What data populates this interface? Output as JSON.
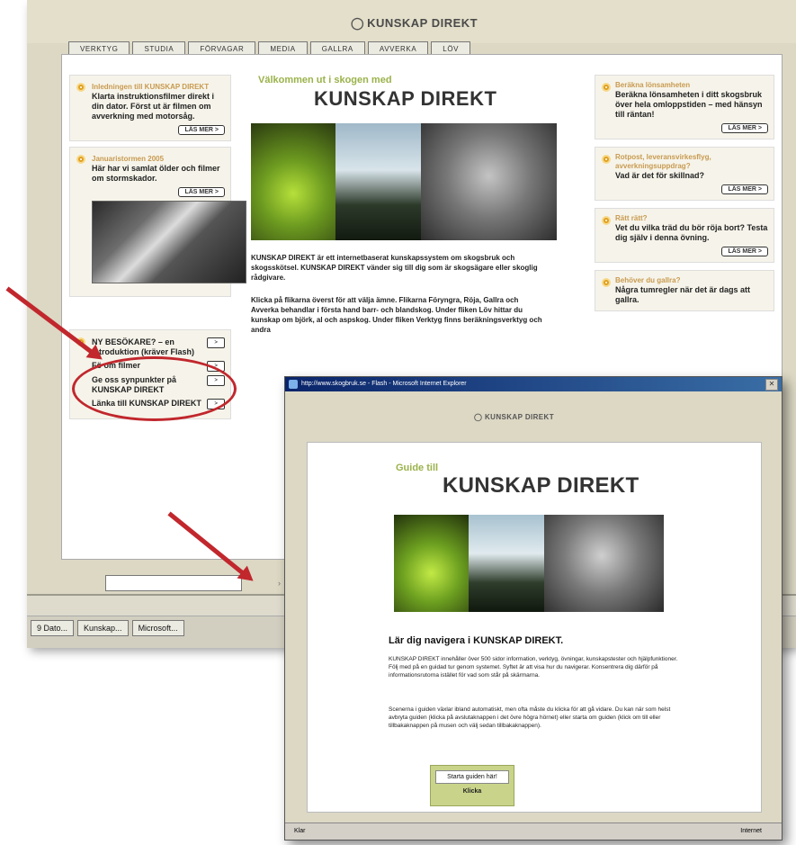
{
  "back_window": {
    "logo": "KUNSKAP DIREKT",
    "tabs": [
      "VERKTYG",
      "STUDIA",
      "FÖRVAGAR",
      "MEDIA",
      "GALLRA",
      "AVVERKA",
      "LÖV"
    ],
    "left_boxes": [
      {
        "muted": "Inledningen till KUNSKAP DIREKT",
        "strong": "Klarta instruktionsfilmer direkt i din dator. Först ut är filmen om avverkning med motorsåg.",
        "button": "LÄS MER >"
      },
      {
        "muted": "Januaristormen 2005",
        "strong": "Här har vi samlat ölder och filmer om stormskador.",
        "button": "LÄS MER >"
      }
    ],
    "left_links": [
      {
        "label": "NY BESÖKARE? – en introduktion (kräver Flash)",
        "button": ">"
      },
      {
        "label": "Fö om filmer",
        "button": ">"
      },
      {
        "label": "Ge oss synpunkter på KUNSKAP DIREKT",
        "button": ">"
      },
      {
        "label": "Länka till KUNSKAP DIREKT",
        "button": ">"
      }
    ],
    "welcome_small": "Välkommen ut i skogen med",
    "welcome_big": "KUNSKAP DIREKT",
    "mid_para1": "KUNSKAP DIREKT är ett internetbaserat kunskapssystem om skogsbruk och skogsskötsel. KUNSKAP DIREKT vänder sig till dig som är skogsägare eller skoglig rådgivare.",
    "mid_para2": "Klicka på flikarna överst för att välja ämne. Flikarna Föryngra, Röja, Gallra och Avverka behandlar i första hand barr- och blandskog. Under fliken Löv hittar du kunskap om björk, al och aspskog. Under fliken Verktyg finns beräkningsverktyg och andra",
    "right_boxes": [
      {
        "muted": "Beräkna lönsamheten",
        "strong": "Beräkna lönsamheten i ditt skogsbruk över hela omloppstiden – med hänsyn till räntan!",
        "button": "LÄS MER >"
      },
      {
        "muted": "Rotpost, leveransvirkesflyg, avverkningsuppdrag?",
        "strong": "Vad är det för skillnad?",
        "button": "LÄS MER >"
      },
      {
        "muted": "Rätt rätt?",
        "strong": "Vet du vilka träd du bör röja bort? Testa dig själv i denna övning.",
        "button": "LÄS MER >"
      },
      {
        "muted": "Behöver du gallra?",
        "strong": "Några tumregler när det är dags att gallra.",
        "button": ""
      }
    ],
    "taskbar": [
      "9 Dato...",
      "Kunskap...",
      "Microsoft...",
      ""
    ]
  },
  "front_window": {
    "title": "http://www.skogbruk.se - Flash - Microsoft Internet Explorer",
    "logo": "KUNSKAP DIREKT",
    "guide_small": "Guide till",
    "guide_big": "KUNSKAP DIREKT",
    "heading": "Lär dig navigera i KUNSKAP DIREKT.",
    "para1": "KUNSKAP DIREKT innehåller över 500 sidor information, verktyg, övningar, kunskapstester och hjälpfunktioner. Följ med på en guidad tur genom systemet. Syftet är att visa hur du navigerar. Konsentrera dig därför på informationsrutorna istället för vad som står på skärmarna.",
    "para2": "Scenerna i guiden växlar ibland automatiskt, men ofta måste du klicka för att gå vidare. Du kan när som helst avbryta guiden (klicka på avslutaknappen i det övre högra hörnet) eller starta om guiden (klick om till eller tillbakaknappen på musen och välj sedan tillbakaknappen).",
    "start_button": "Starta guiden här!",
    "start_sub": "Klicka",
    "status_done": "Klar",
    "status_zone": "Internet"
  }
}
